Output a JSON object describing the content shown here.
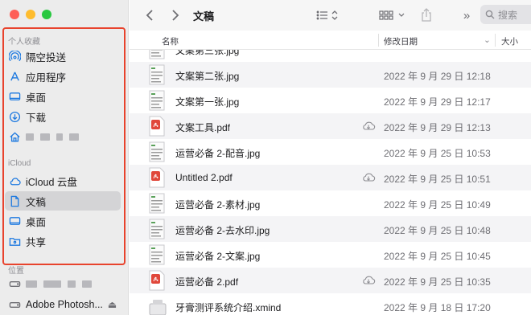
{
  "window": {
    "title": "文稿"
  },
  "toolbar": {
    "search_placeholder": "搜索",
    "back_icon": "chevron-left-icon",
    "forward_icon": "chevron-right-icon"
  },
  "sidebar": {
    "favorites_header": "个人收藏",
    "favorites": [
      {
        "label": "隔空投送",
        "icon": "airdrop-icon"
      },
      {
        "label": "应用程序",
        "icon": "applications-icon"
      },
      {
        "label": "桌面",
        "icon": "desktop-icon"
      },
      {
        "label": "下载",
        "icon": "download-icon"
      },
      {
        "label": "",
        "icon": "home-icon"
      }
    ],
    "icloud_header": "iCloud",
    "icloud": [
      {
        "label": "iCloud 云盘",
        "icon": "cloud-icon"
      },
      {
        "label": "文稿",
        "icon": "document-icon",
        "selected": true
      },
      {
        "label": "桌面",
        "icon": "desktop-icon"
      },
      {
        "label": "共享",
        "icon": "shared-folder-icon"
      }
    ],
    "locations_header": "位置",
    "locations": [
      {
        "label": "",
        "icon": "disk-icon"
      },
      {
        "label": "Adobe Photosh...",
        "icon": "disk-icon"
      }
    ],
    "accent_color": "#1f7ae0",
    "highlight_color": "#e8432d"
  },
  "columns": {
    "name": "名称",
    "modified": "修改日期",
    "size": "大小"
  },
  "files": [
    {
      "name": "文案第三张.jpg",
      "date": "",
      "type": "image",
      "cloud": false
    },
    {
      "name": "文案第二张.jpg",
      "date": "2022 年 9 月 29 日 12:18",
      "type": "image",
      "cloud": false
    },
    {
      "name": "文案第一张.jpg",
      "date": "2022 年 9 月 29 日 12:17",
      "type": "image",
      "cloud": false
    },
    {
      "name": "文案工具.pdf",
      "date": "2022 年 9 月 29 日 12:13",
      "type": "pdf",
      "cloud": true
    },
    {
      "name": "运营必备 2-配音.jpg",
      "date": "2022 年 9 月 25 日 10:53",
      "type": "image",
      "cloud": false
    },
    {
      "name": "Untitled 2.pdf",
      "date": "2022 年 9 月 25 日 10:51",
      "type": "pdf",
      "cloud": true
    },
    {
      "name": "运营必备 2-素材.jpg",
      "date": "2022 年 9 月 25 日 10:49",
      "type": "image",
      "cloud": false
    },
    {
      "name": "运营必备 2-去水印.jpg",
      "date": "2022 年 9 月 25 日 10:48",
      "type": "image",
      "cloud": false
    },
    {
      "name": "运营必备 2-文案.jpg",
      "date": "2022 年 9 月 25 日 10:45",
      "type": "image",
      "cloud": false
    },
    {
      "name": "运营必备 2.pdf",
      "date": "2022 年 9 月 25 日 10:35",
      "type": "pdf",
      "cloud": true
    },
    {
      "name": "牙膏测评系统介绍.xmind",
      "date": "2022 年 9 月 18 日 17:20",
      "type": "xmind",
      "cloud": false
    }
  ]
}
